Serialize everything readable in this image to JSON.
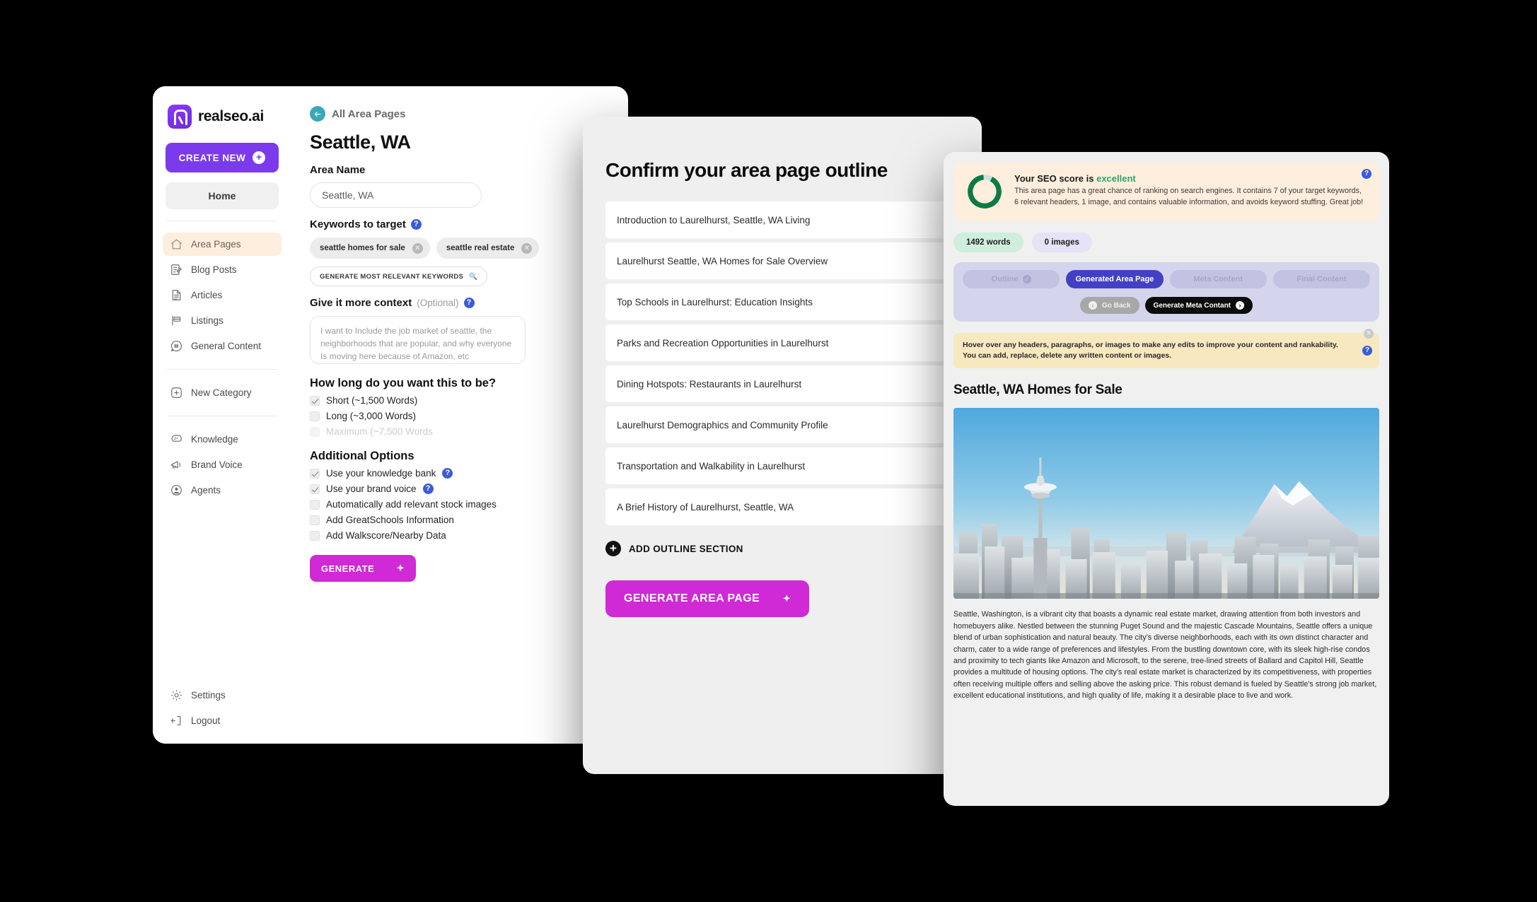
{
  "app": {
    "brand_name": "realseo.ai",
    "create_new_label": "CREATE NEW",
    "home_label": "Home",
    "nav_primary": [
      {
        "label": "Area Pages",
        "icon": "house-icon",
        "active": true
      },
      {
        "label": "Blog Posts",
        "icon": "note-pencil-icon",
        "active": false
      },
      {
        "label": "Articles",
        "icon": "document-icon",
        "active": false
      },
      {
        "label": "Listings",
        "icon": "sign-post-icon",
        "active": false
      },
      {
        "label": "General Content",
        "icon": "hash-bubble-icon",
        "active": false
      }
    ],
    "nav_new_category": {
      "label": "New Category",
      "icon": "plus-square-icon"
    },
    "nav_secondary": [
      {
        "label": "Knowledge",
        "icon": "brain-icon"
      },
      {
        "label": "Brand Voice",
        "icon": "megaphone-icon"
      },
      {
        "label": "Agents",
        "icon": "user-circle-icon"
      }
    ],
    "nav_footer": [
      {
        "label": "Settings",
        "icon": "gear-icon"
      },
      {
        "label": "Logout",
        "icon": "logout-icon"
      }
    ]
  },
  "form": {
    "back_link": "All Area Pages",
    "page_title": "Seattle, WA",
    "area_name_label": "Area Name",
    "area_name_value": "Seattle, WA",
    "keywords_label": "Keywords to target",
    "keywords": [
      "seattle homes for sale",
      "seattle real estate"
    ],
    "generate_keywords_label": "GENERATE MOST RELEVANT KEYWORDS",
    "generate_keywords_icon": "magnifier-icon",
    "context_label": "Give it more context",
    "context_optional": "(Optional)",
    "context_placeholder": "I want to Include the job market of seattle, the neighborhoods that are popular, and why everyone Is moving here because of Amazon, etc",
    "length_title": "How long do you want this to be?",
    "length_options": [
      {
        "label": "Short (~1,500 Words)",
        "checked": true,
        "disabled": false
      },
      {
        "label": "Long (~3,000 Words)",
        "checked": false,
        "disabled": false
      },
      {
        "label": "Maximum (~7,500 Words",
        "checked": false,
        "disabled": true
      }
    ],
    "additional_title": "Additional Options",
    "additional_options": [
      {
        "label": "Use your knowledge bank",
        "checked": true,
        "help": true
      },
      {
        "label": "Use your brand voice",
        "checked": true,
        "help": true
      },
      {
        "label": "Automatically add relevant stock images",
        "checked": false,
        "help": false
      },
      {
        "label": "Add GreatSchools Information",
        "checked": false,
        "help": false
      },
      {
        "label": "Add Walkscore/Nearby Data",
        "checked": false,
        "help": false
      }
    ],
    "generate_label": "GENERATE",
    "help_glyph": "?"
  },
  "outline": {
    "title": "Confirm your area page outline",
    "sections": [
      "Introduction to Laurelhurst, Seattle, WA Living",
      "Laurelhurst Seattle, WA Homes for Sale Overview",
      "Top Schools in Laurelhurst: Education Insights",
      "Parks and Recreation Opportunities in Laurelhurst",
      "Dining Hotspots: Restaurants in Laurelhurst",
      "Laurelhurst Demographics and Community Profile",
      "Transportation and Walkability in Laurelhurst",
      "A Brief History of Laurelhurst, Seattle, WA"
    ],
    "add_section_label": "ADD OUTLINE SECTION",
    "generate_label": "GENERATE AREA PAGE"
  },
  "preview": {
    "seo_head_prefix": "Your SEO score is ",
    "seo_head_value": "excellent",
    "seo_body": "This area page has a great chance of ranking on search engines. It contains 7 of your target keywords, 6 relevant headers, 1 image, and contains valuable information, and avoids keyword stuffing. Great job!",
    "words_pill": "1492 words",
    "images_pill": "0 images",
    "steps": [
      {
        "label": "Outline",
        "state": "done"
      },
      {
        "label": "Generated Area Page",
        "state": "current"
      },
      {
        "label": "Meta Content",
        "state": "pending"
      },
      {
        "label": "Final Content",
        "state": "pending"
      }
    ],
    "go_back_label": "Go Back",
    "generate_meta_label": "Generate Meta Contant",
    "hint_text": "Hover over any headers, paragraphs, or images to make any edits to improve your content and rankability. You can add, replace, delete any written content or images.",
    "article_title": "Seattle, WA Homes for Sale",
    "article_body": "Seattle, Washington, is a vibrant city that boasts a dynamic real estate market, drawing attention from both investors and homebuyers alike. Nestled between the stunning Puget Sound and the majestic Cascade Mountains, Seattle offers a unique blend of urban sophistication and natural beauty. The city's diverse neighborhoods, each with its own distinct character and charm, cater to a wide range of preferences and lifestyles. From the bustling downtown core, with its sleek high-rise condos and proximity to tech giants like Amazon and Microsoft, to the serene, tree-lined streets of Ballard and Capitol Hill, Seattle provides a multitude of housing options. The city's real estate market is characterized by its competitiveness, with properties often receiving multiple offers and selling above the asking price. This robust demand is fueled by Seattle's strong job market, excellent educational institutions, and high quality of life, making it a desirable place to live and work.",
    "hero_alt": "seattle-skyline-space-needle-mount-rainier-photo",
    "colors": {
      "seo_card_bg": "#fdeedd",
      "excellent": "#2aa76c",
      "ring": "#0e7a43",
      "current_step": "#4240c4",
      "accent_magenta": "#cf2ad6",
      "accent_purple": "#7c3aed"
    }
  }
}
